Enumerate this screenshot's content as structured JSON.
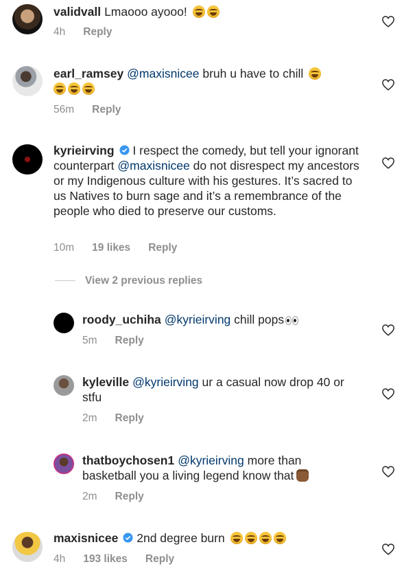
{
  "colors": {
    "text": "#262626",
    "meta": "#8e8e8e",
    "mention": "#00376b",
    "verified": "#3897f0"
  },
  "view_replies_label": "View 2 previous replies",
  "comments": [
    {
      "username": "validvall",
      "verified": false,
      "text_before": "Lmaooo ayooo!",
      "mention": "",
      "text_after": "",
      "emoji_count": 2,
      "emoji": "face-with-tears-of-joy",
      "time": "4h",
      "likes": "",
      "reply_label": "Reply"
    },
    {
      "username": "earl_ramsey",
      "verified": false,
      "text_before": "",
      "mention": "@maxisnicee",
      "text_after": "bruh u have to chill",
      "emoji_count": 4,
      "emoji": "face-with-tears-of-joy",
      "time": "56m",
      "likes": "",
      "reply_label": "Reply"
    },
    {
      "username": "kyrieirving",
      "verified": true,
      "text_before": "I respect the comedy, but tell your ignorant counterpart",
      "mention": "@maxisnicee",
      "text_after": "do not disrespect my ancestors or my Indigenous culture with his gestures. It’s sacred to us Natives to burn sage and it’s a remembrance of the people who died to preserve our customs.",
      "emoji_count": 0,
      "emoji": "",
      "time": "10m",
      "likes": "19 likes",
      "reply_label": "Reply"
    },
    {
      "username": "roody_uchiha",
      "verified": false,
      "text_before": "",
      "mention": "@kyrieirving",
      "text_after": "chill pops",
      "emoji_count": 1,
      "emoji": "eyes",
      "time": "5m",
      "likes": "",
      "reply_label": "Reply"
    },
    {
      "username": "kyleville",
      "verified": false,
      "text_before": "",
      "mention": "@kyrieirving",
      "text_after": "ur a casual now drop 40 or stfu",
      "emoji_count": 0,
      "emoji": "",
      "time": "2m",
      "likes": "",
      "reply_label": "Reply"
    },
    {
      "username": "thatboychosen1",
      "verified": false,
      "text_before": "",
      "mention": "@kyrieirving",
      "text_after": "more than basketball you a living legend know that",
      "emoji_count": 1,
      "emoji": "raised-fist",
      "time": "2m",
      "likes": "",
      "reply_label": "Reply"
    },
    {
      "username": "maxisnicee",
      "verified": true,
      "text_before": "2nd degree burn",
      "mention": "",
      "text_after": "",
      "emoji_count": 4,
      "emoji": "face-with-tears-of-joy",
      "time": "4h",
      "likes": "193 likes",
      "reply_label": "Reply"
    }
  ]
}
